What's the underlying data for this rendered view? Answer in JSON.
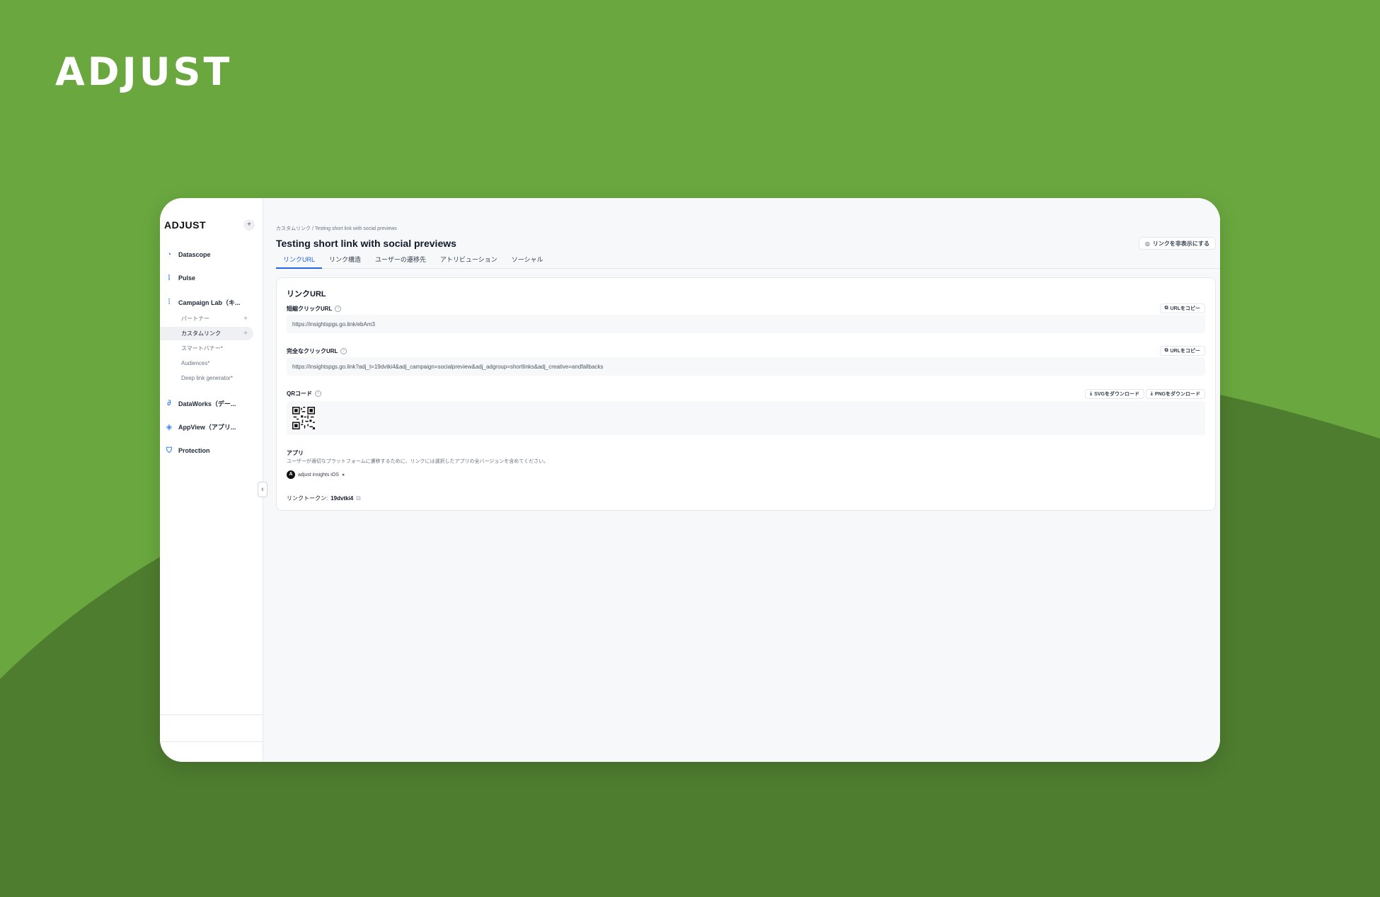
{
  "brand": "ADJUST",
  "colors": {
    "background": "#6aa83f",
    "background_dark": "#4e7d2f",
    "accent": "#2563eb"
  },
  "sidebar": {
    "logo": "ADJUST",
    "items": [
      {
        "label": "Datascope",
        "icon": "datascope-icon"
      },
      {
        "label": "Pulse",
        "icon": "pulse-icon"
      },
      {
        "label": "Campaign Lab（キ...",
        "icon": "campaign-lab-icon"
      },
      {
        "label": "DataWorks（デー...",
        "icon": "dataworks-icon"
      },
      {
        "label": "AppView（アプリ...",
        "icon": "appview-icon"
      },
      {
        "label": "Protection",
        "icon": "protection-icon"
      }
    ],
    "sub_items": [
      {
        "label": "パートナー"
      },
      {
        "label": "カスタムリンク"
      },
      {
        "label": "スマートバナー*"
      },
      {
        "label": "Audiences*"
      },
      {
        "label": "Deep link generator*"
      }
    ]
  },
  "header": {
    "breadcrumb": "カスタムリンク / Testing short link with social previews",
    "title": "Testing short link with social previews",
    "hide_button": "リンクを非表示にする"
  },
  "tabs": [
    "リンクURL",
    "リンク構造",
    "ユーザーの遷移先",
    "アトリビューション",
    "ソーシャル"
  ],
  "card": {
    "title": "リンクURL",
    "short_url_label": "短縮クリックURL",
    "short_url": "https://insightspgs.go.link/ebAm3",
    "full_url_label": "完全なクリックURL",
    "full_url": "https://insightspgs.go.link?adj_t=19dvtki4&adj_campaign=socialpreview&adj_adgroup=shortlinks&adj_creative=andfallbacks",
    "copy_label": "URLをコピー",
    "qr_label": "QRコード",
    "svg_download": "SVGをダウンロード",
    "png_download": "PNGをダウンロード",
    "app_title": "アプリ",
    "app_desc": "ユーザーが適切なプラットフォームに遷移するために、リンクには選択したアプリの全バージョンを含めてください。",
    "app_name": "adjust insights iOS",
    "token_label": "リンクトークン:",
    "token_value": "19dvtki4"
  }
}
